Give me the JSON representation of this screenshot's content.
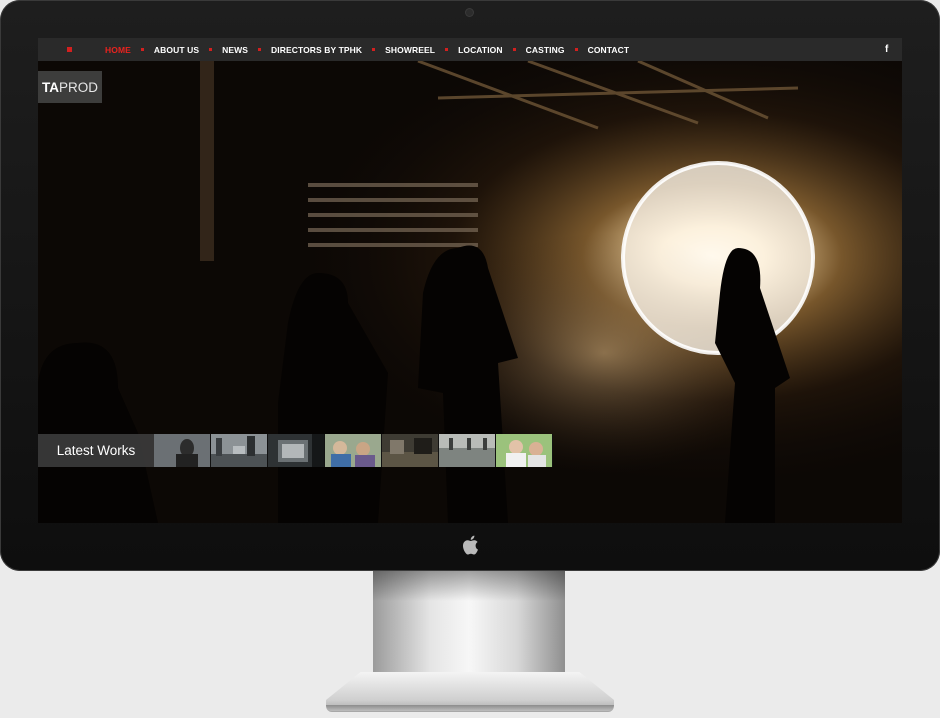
{
  "site": {
    "logo_bold": "TA",
    "logo_light": "PROD"
  },
  "nav": {
    "items": [
      {
        "label": "HOME",
        "active": true
      },
      {
        "label": "ABOUT US",
        "active": false
      },
      {
        "label": "NEWS",
        "active": false
      },
      {
        "label": "DIRECTORS by TPHK",
        "active": false
      },
      {
        "label": "SHOWREEL",
        "active": false
      },
      {
        "label": "LOCATION",
        "active": false
      },
      {
        "label": "CASTING",
        "active": false
      },
      {
        "label": "CONTACT",
        "active": false
      }
    ],
    "social_icon": "facebook-icon",
    "social_glyph": "f"
  },
  "works": {
    "title": "Latest Works",
    "thumbnails": [
      "thumb-1",
      "thumb-2",
      "thumb-3",
      "thumb-4",
      "thumb-5",
      "thumb-6",
      "thumb-7"
    ]
  },
  "colors": {
    "accent": "#e8231f",
    "navbar": "#2a2a2a",
    "frame": "#151515"
  }
}
